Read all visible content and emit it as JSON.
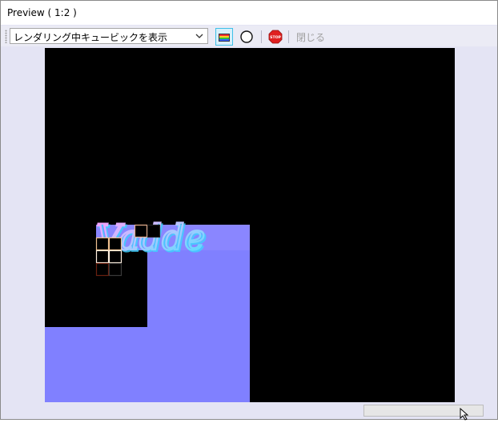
{
  "window": {
    "title": "Preview ( 1:2 )"
  },
  "toolbar": {
    "mode_select": {
      "value": "レンダリング中キュービックを表示"
    },
    "buttons": [
      {
        "icon": "color-palette-icon",
        "checked": true
      },
      {
        "icon": "circle-icon",
        "checked": false
      },
      {
        "icon": "stop-icon",
        "text": "STOP",
        "checked": false
      }
    ],
    "close_label": "閉じる"
  },
  "preview": {
    "watermark_text": "Vadde",
    "colors": {
      "background": "#000000",
      "normal_map": "#8080ff",
      "bucket_border": "#ffe4c4"
    }
  },
  "progress": {
    "value": 0
  }
}
